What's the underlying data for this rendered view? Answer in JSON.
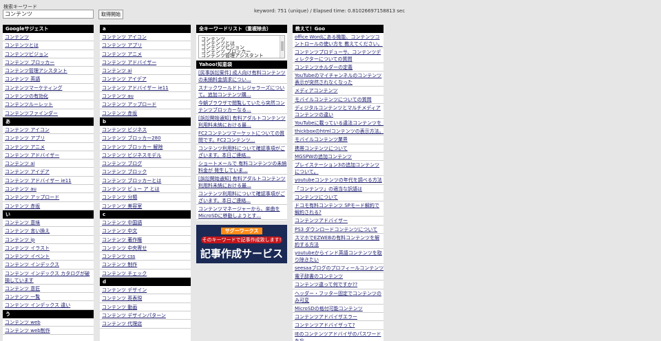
{
  "search": {
    "label": "検索キーワード",
    "value": "コンテンツ",
    "button": "取得開始",
    "stats": "keyword: 751 (unique) / Elapsed time: 0.81026697158813 sec"
  },
  "google": {
    "title": "Googleサジェスト",
    "items": [
      "コンテンツ",
      "コンテンツとは",
      "コンテンツビジョン",
      "コンテンツ ブロッカー",
      "コンテンツ管理アシスタント",
      "コンテンツ 英語",
      "コンテンツマーケティング",
      "コンテンツの有効化",
      "コンテンツルーレット",
      "コンテンツファインダー"
    ]
  },
  "sec_a_jp": {
    "title": "あ",
    "items": [
      "コンテンツ アイコン",
      "コンテンツ アプリ",
      "コンテンツ アニメ",
      "コンテンツ アドバイザー",
      "コンテンツ ai",
      "コンテンツ アイデア",
      "コンテンツ アドバイザー ie11",
      "コンテンツ au",
      "コンテンツ アップロード",
      "コンテンツ 赤坂"
    ]
  },
  "sec_i": {
    "title": "い",
    "items": [
      "コンテンツ 意味",
      "コンテンツ 言い換え",
      "コンテンツ ip",
      "コンテンツ イラスト",
      "コンテンツ イベント",
      "コンテンツ インデックス",
      "コンテンツ インデックス カタログが破損しています",
      "コンテンツ 意匠",
      "コンテンツ 一覧",
      "コンテンツ インデックス 違い"
    ]
  },
  "sec_u": {
    "title": "う",
    "items": [
      "コンテンツ web",
      "コンテンツ web制作"
    ]
  },
  "sec_a": {
    "title": "a",
    "items": [
      "コンテンツ アイコン",
      "コンテンツ アプリ",
      "コンテンツ アニメ",
      "コンテンツ アドバイザー",
      "コンテンツ ai",
      "コンテンツ アイデア",
      "コンテンツ アドバイザー ie11",
      "コンテンツ au",
      "コンテンツ アップロード",
      "コンテンツ 赤坂"
    ]
  },
  "sec_b": {
    "title": "b",
    "items": [
      "コンテンツ ビジネス",
      "コンテンツ ブロッカー280",
      "コンテンツ ブロッカー 解除",
      "コンテンツ ビジネスモデル",
      "コンテンツ ブログ",
      "コンテンツ ブロック",
      "コンテンツ ブロッカーとは",
      "コンテンツ ビュー ア とは",
      "コンテンツ 分類",
      "コンテンツ 美容室"
    ]
  },
  "sec_c": {
    "title": "c",
    "items": [
      "コンテンツ 中国語",
      "コンテンツ 中文",
      "コンテンツ 著作権",
      "コンテンツ 中央寄せ",
      "コンテンツ css",
      "コンテンツ 制作",
      "コンテンツ チェック"
    ]
  },
  "sec_d": {
    "title": "d",
    "items": [
      "コンテンツ デザイン",
      "コンテンツ 英表現",
      "コンテンツ 動画",
      "コンテンツ デザインパターン",
      "コンテンツ 代理店"
    ]
  },
  "kwlist": {
    "title": "全キーワードリスト（重複除去）",
    "lines": [
      "コンテンツ",
      "コンテンツとは",
      "コンテンツビジョン",
      "コンテンツ ブロッカー",
      "コンテンツ管理アシスタント"
    ]
  },
  "yahoo": {
    "title": "Yahoo!知恵袋",
    "items": [
      "[民事訴訟案件] 成人向け有料コンテンツの未納料金請求につい...",
      "スナックワールドトレジャラーズについて。追加コンテンツ購...",
      "今朝ブラウザで閲覧していたら突然コンテンツブロッカーなる...",
      "[訴訟開始通知] 有料アダルトコンテンツ利用料未納における最...",
      "FC2コンテンツマーケットについての質問です。FC2コンテンツ...",
      "コンテンツ利用料について確認事項がございます。本日ご連絡...",
      "ショートメールで 有料コンテンツの未納料金が 発生していま...",
      "[訴訟開始通知] 有料アダルトコンテンツ利用料未納における最...",
      "コンテンツ利用料について確認事項がございます。本日ご連絡...",
      "コンテンツマネージャーから、楽曲をMicroSDに移動しようとす..."
    ]
  },
  "ad": {
    "top": "サグーワークス",
    "sub": "そのキーワードで記事作成致します!",
    "main": "記事作成サービス"
  },
  "goo": {
    "title": "教えて！Goo",
    "items": [
      "office Wordにある機能、コンテンツコントロールの使い方を 教えてください。",
      "コンテンツプロデューサ、コンテンツディレクターについての質問",
      "コンテンツホルダーの定義",
      "YouTubeのマイチャンネルのコンテンツ表示が突然されなくなった",
      "メディアコンテンツ",
      "モバイルコンテンツについての質問",
      "ディジタルコンテンツとマルチメディアコンテンツの違い",
      "YouTubeに載っている違法コンテンツを・・・",
      "thickboxのhtmlコンテンツの表示方法。",
      "モバイルコンテンツ業界",
      "携帯コンテンツについて",
      "MGSPWの追加コンテンツ",
      "プレイステーション3の追加コンテンツについて。",
      "youtubeコンテンツの年代を調べる方法",
      "「コンテンツ」の適当な訳語は",
      "コンテンツについて",
      "ドコモ有料コンテンツ SPモード解約で解約される?",
      "コンテンツアドバイザー",
      "PS3 ダウンロードコンテンツについて",
      "スマホでEZWEBの有料コンテンツを解約する方法",
      "youtubeからインド英語コンテンツを取り除きたい",
      "seesaaブログのプロフィールコンテンツ",
      "電子辞書のコンテンツ",
      "コンテンツ違って何ですか??",
      "ヘッダー・フッター固定でコンテンツのみ可変",
      "MicroSDの格付可能コンテンツ",
      "コンテンツアドバイザエラー",
      "コンテンツアドバイザって?",
      "IEのコンテンツアドバイザのパスワードを忘"
    ]
  }
}
